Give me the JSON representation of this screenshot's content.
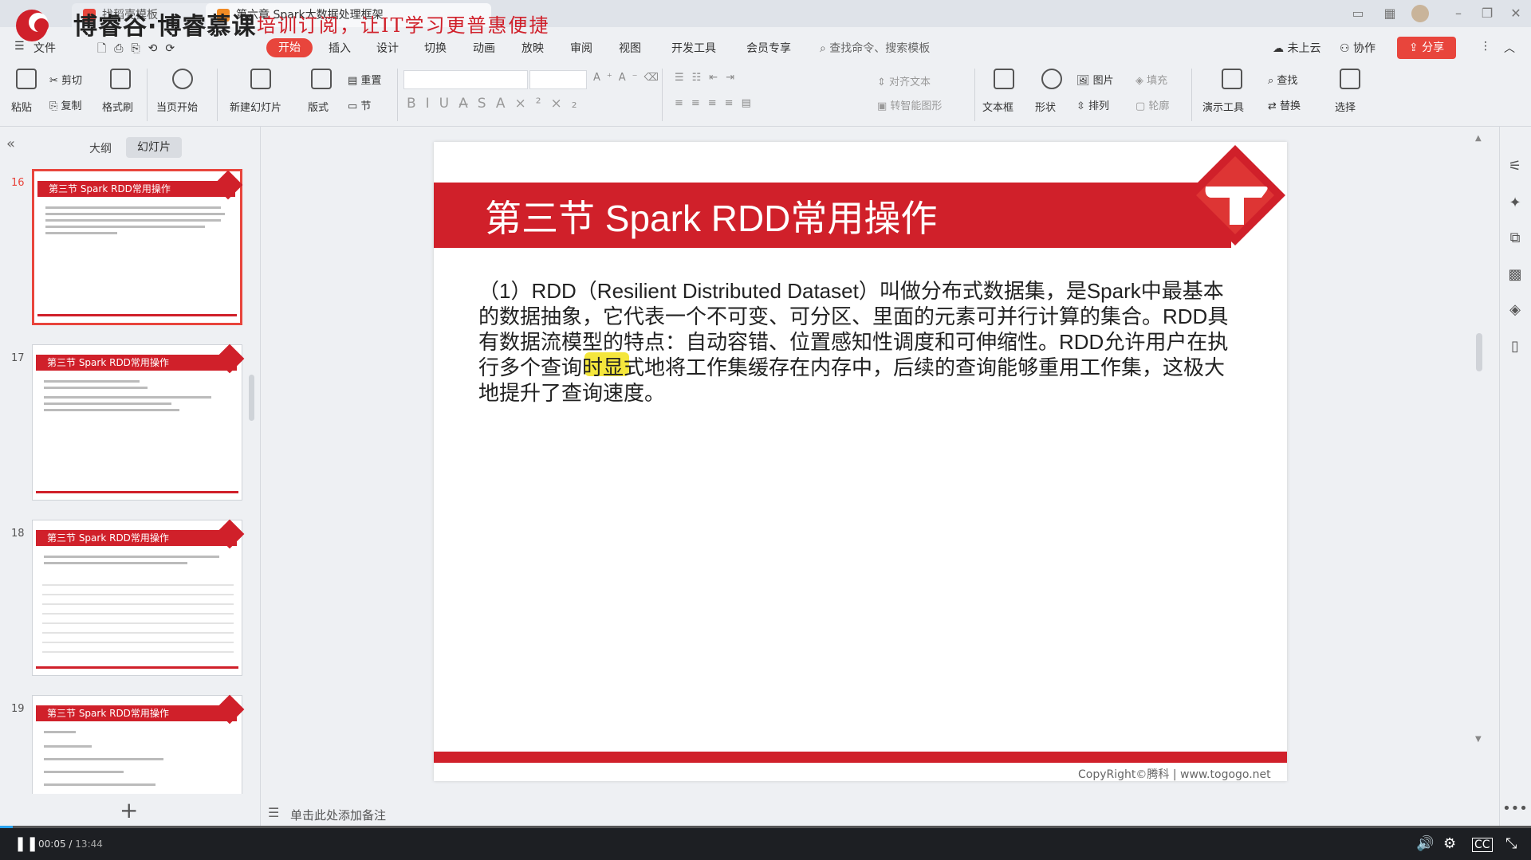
{
  "brand": {
    "name": "博睿谷·博睿慕课",
    "slogan": "培训订阅，让IT学习更普惠便捷"
  },
  "tabs": [
    {
      "label": "找稻壳模板"
    },
    {
      "label": "第六章 Spark大数据处理框架"
    }
  ],
  "menu": {
    "items": [
      "文件",
      "开始",
      "插入",
      "设计",
      "切换",
      "动画",
      "放映",
      "审阅",
      "视图",
      "开发工具",
      "会员专享"
    ],
    "search": "查找命令、搜索模板",
    "cloud": "未上云",
    "collab": "协作",
    "share": "分享"
  },
  "ribbon": {
    "paste": "粘贴",
    "cut": "剪切",
    "copy": "复制",
    "format_painter": "格式刷",
    "from_current": "当页开始",
    "new_slide": "新建幻灯片",
    "layout": "版式",
    "section": "节",
    "reset": "重置",
    "align_text": "对齐文本",
    "smart_shape": "转智能图形",
    "textbox": "文本框",
    "shape": "形状",
    "picture": "图片",
    "fill": "填充",
    "arrange": "排列",
    "outline": "轮廓",
    "present_tools": "演示工具",
    "find": "查找",
    "replace": "替换",
    "select": "选择"
  },
  "left_panel": {
    "outline_tab": "大纲",
    "slides_tab": "幻灯片",
    "thumbnails": [
      {
        "num": "16",
        "title": "第三节 Spark RDD常用操作",
        "selected": true
      },
      {
        "num": "17",
        "title": "第三节 Spark RDD常用操作",
        "selected": false
      },
      {
        "num": "18",
        "title": "第三节 Spark RDD常用操作",
        "selected": false
      },
      {
        "num": "19",
        "title": "第三节 Spark RDD常用操作",
        "selected": false
      }
    ],
    "add": "+"
  },
  "slide": {
    "title": "第三节 Spark RDD常用操作",
    "body": "（1）RDD（Resilient Distributed Dataset）叫做分布式数据集，是Spark中最基本的数据抽象，它代表一个不可变、可分区、里面的元素可并行计算的集合。RDD具有数据流模型的特点：自动容错、位置感知性调度和可伸缩性。RDD允许用户在执行多个查询时显式地将工作集缓存在内存中，后续的查询能够重用工作集，这极大地提升了查询速度。",
    "copyright": "CopyRight©腾科 | www.togogo.net",
    "accent": "#d0202a"
  },
  "notes": {
    "placeholder": "单击此处添加备注"
  },
  "video": {
    "current": "00:05",
    "total": "13:44",
    "separator": "/"
  }
}
